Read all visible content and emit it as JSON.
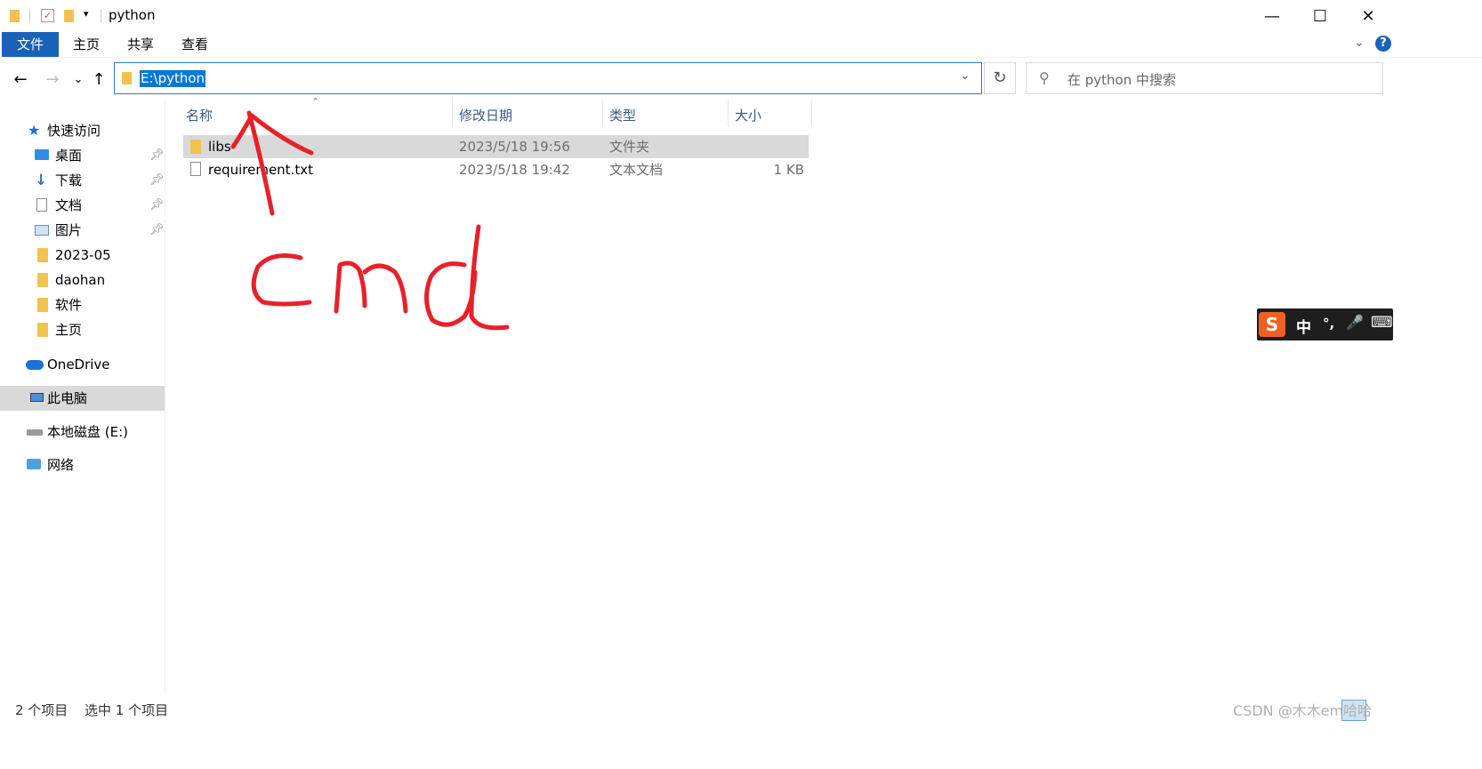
{
  "window": {
    "title": "python",
    "min_glyph": "—",
    "max_glyph": "☐",
    "close_glyph": "✕"
  },
  "ribbon": {
    "tabs": [
      "文件",
      "主页",
      "共享",
      "查看"
    ],
    "help_glyph": "?"
  },
  "address": {
    "path": "E:\\python",
    "refresh_glyph": "↻",
    "dropdown_glyph": "⌄",
    "back_glyph": "←",
    "forward_glyph": "→",
    "recent_glyph": "⌄",
    "up_glyph": "↑"
  },
  "search": {
    "placeholder": "在 python 中搜索"
  },
  "sidebar": {
    "quick_access": "快速访问",
    "items": [
      {
        "label": "桌面",
        "pinned": true
      },
      {
        "label": "下载",
        "pinned": true
      },
      {
        "label": "文档",
        "pinned": true
      },
      {
        "label": "图片",
        "pinned": true
      },
      {
        "label": "2023-05",
        "pinned": false
      },
      {
        "label": "daohan",
        "pinned": false
      },
      {
        "label": "软件",
        "pinned": false
      },
      {
        "label": "主页",
        "pinned": false
      }
    ],
    "onedrive": "OneDrive",
    "this_pc": "此电脑",
    "local_disk": "本地磁盘 (E:)",
    "network": "网络"
  },
  "columns": {
    "name": "名称",
    "modified": "修改日期",
    "type": "类型",
    "size": "大小"
  },
  "files": [
    {
      "name": "libs",
      "modified": "2023/5/18 19:56",
      "type": "文件夹",
      "size": "",
      "selected": true
    },
    {
      "name": "requirement.txt",
      "modified": "2023/5/18 19:42",
      "type": "文本文档",
      "size": "1 KB",
      "selected": false
    }
  ],
  "status": {
    "count": "2 个项目",
    "selected": "选中 1 个项目"
  },
  "annotation": {
    "text": "cmd",
    "color": "#e8202a"
  },
  "ime": {
    "mode": "中",
    "punct": "°,",
    "mic": "🎤",
    "keyboard": "⌨"
  },
  "watermark": "CSDN @木木em哈哈"
}
